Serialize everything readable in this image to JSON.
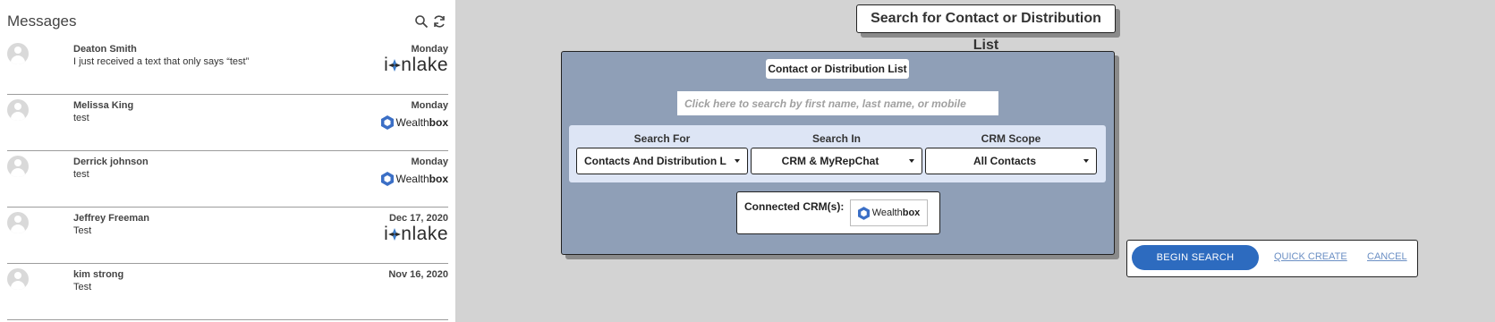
{
  "messages_panel": {
    "title": "Messages",
    "items": [
      {
        "name": "Deaton Smith",
        "text": "I just received a text that only says “test”",
        "date": "Monday",
        "logo": "ionlake"
      },
      {
        "name": "Melissa King",
        "text": "test",
        "date": "Monday",
        "logo": "wealthbox"
      },
      {
        "name": "Derrick johnson",
        "text": "test",
        "date": "Monday",
        "logo": "wealthbox"
      },
      {
        "name": "Jeffrey Freeman",
        "text": "Test",
        "date": "Dec 17, 2020",
        "logo": "ionlake"
      },
      {
        "name": "kim strong",
        "text": "Test",
        "date": "Nov 16, 2020",
        "logo": "none"
      }
    ],
    "icons": [
      "search-icon",
      "refresh-icon",
      "avatar-icon"
    ]
  },
  "logos": {
    "ionlake": {
      "prefix": "i",
      "suffix": "nlake"
    },
    "wealthbox": {
      "bold": "box",
      "light": "Wealth"
    }
  },
  "search": {
    "title": "Search for Contact or Distribution List",
    "heading": "Contact or Distribution List",
    "placeholder": "Click here to search by first name, last name, or mobile",
    "filters": {
      "search_for": {
        "label": "Search For",
        "value": "Contacts And Distribution L"
      },
      "search_in": {
        "label": "Search In",
        "value": "CRM & MyRepChat"
      },
      "crm_scope": {
        "label": "CRM Scope",
        "value": "All Contacts"
      }
    },
    "connected_label": "Connected CRM(s):"
  },
  "actions": {
    "begin": "BEGIN SEARCH",
    "quick_create": "QUICK CREATE",
    "cancel": "CANCEL"
  },
  "colors": {
    "accent": "#2d6bbf",
    "search_box_bg": "#8f9fb7",
    "filters_bg": "#dde5f5",
    "wealthbox_blue": "#3b6fc6"
  }
}
